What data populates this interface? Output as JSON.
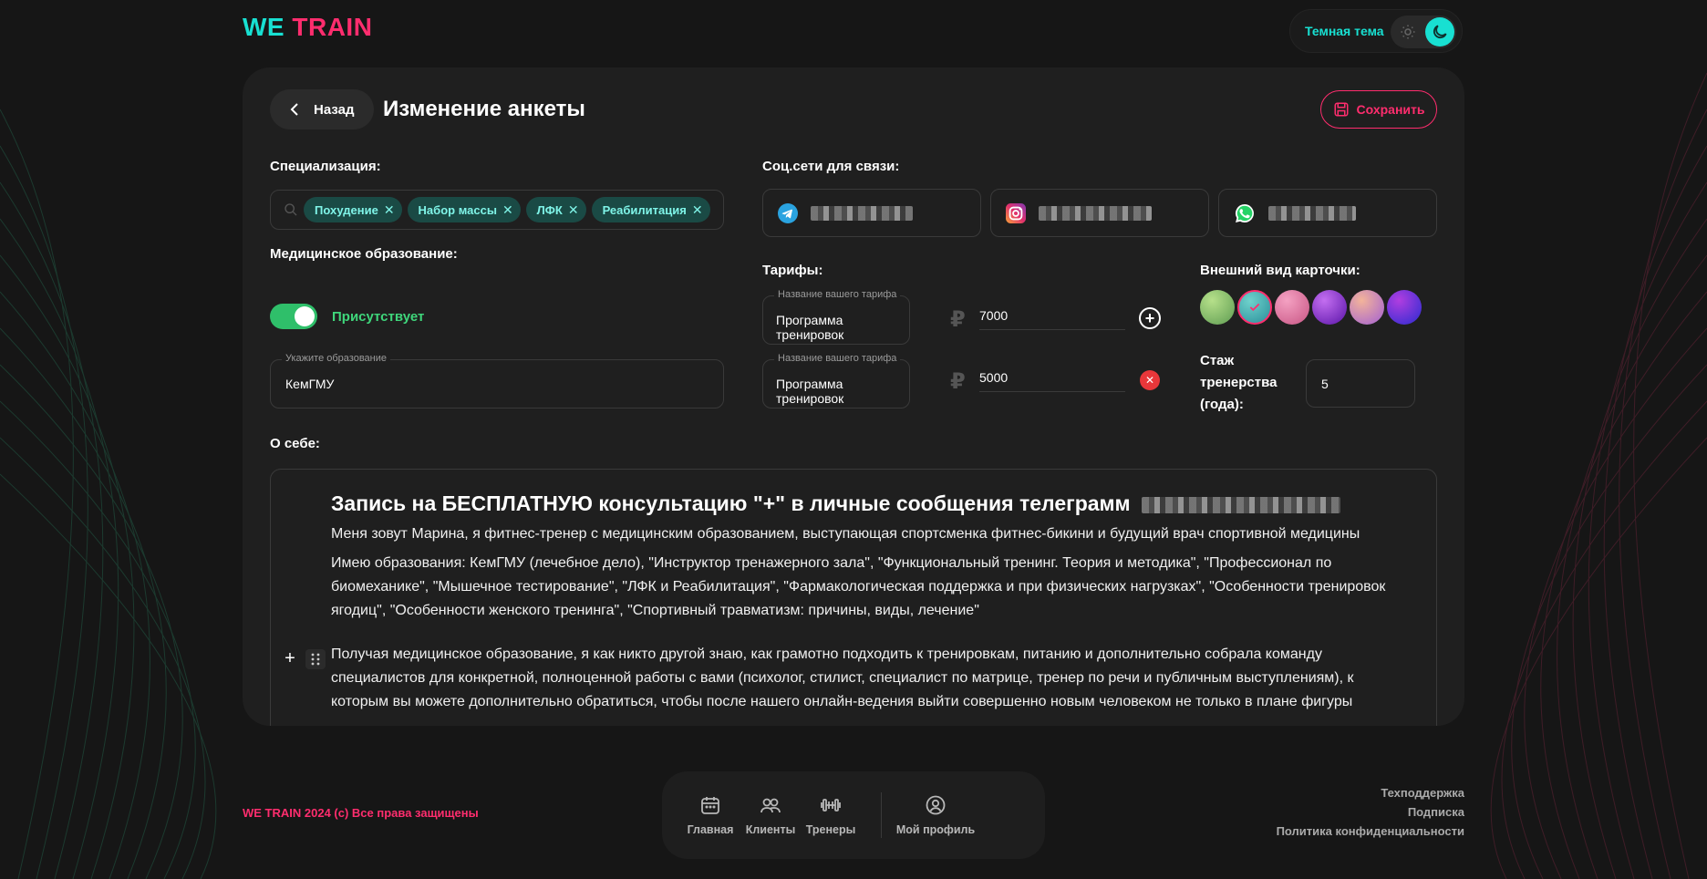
{
  "brand": {
    "part1": "WE",
    "part2": "TRAIN"
  },
  "theme": {
    "label": "Темная тема"
  },
  "header": {
    "back_label": "Назад",
    "title": "Изменение анкеты",
    "save_label": "Сохранить"
  },
  "specialization": {
    "label": "Специализация:",
    "chips": [
      "Похудение",
      "Набор массы",
      "ЛФК",
      "Реабилитация"
    ]
  },
  "social": {
    "label": "Соц.сети для связи:",
    "networks": [
      "telegram-icon",
      "instagram-icon",
      "whatsapp-icon"
    ]
  },
  "medical": {
    "label": "Медицинское образование:",
    "toggle_state": "Присутствует",
    "education_legend": "Укажите образование",
    "education_value": "КемГМУ"
  },
  "tariffs": {
    "label": "Тарифы:",
    "items": [
      {
        "legend": "Название вашего тарифа",
        "name": "Программа тренировок",
        "price": "7000"
      },
      {
        "legend": "Название вашего тарифа",
        "name": "Программа тренировок",
        "price": "5000"
      }
    ]
  },
  "appearance": {
    "label": "Внешний вид карточки:",
    "swatches": [
      "#7fc36a",
      "#3ab3b0",
      "#e46aa0",
      "#8a2bd6",
      "#c57ad8",
      "#4b2fd6"
    ],
    "selected_index": 1
  },
  "experience": {
    "label": "Стаж тренерства (года):",
    "value": "5"
  },
  "about": {
    "label": "О себе:",
    "heading": "Запись на БЕСПЛАТНУЮ консультацию \"+\" в личные сообщения телеграмм",
    "p1": "Меня зовут Марина, я фитнес-тренер с медицинским образованием, выступающая спортсменка фитнес-бикини и будущий врач спортивной медицины",
    "p2": "Имею образования: КемГМУ (лечебное дело), \"Инструктор тренажерного зала\", \"Функциональный тренинг. Теория и методика\", \"Профессионал по биомеханике\", \"Мышечное тестирование\", \"ЛФК и Реабилитация\", \"Фармакологическая поддержка и при физических нагрузках\", \"Особенности тренировок ягодиц\", \"Особенности женского тренинга\", \"Спортивный травматизм: причины, виды, лечение\"",
    "p3": "Получая медицинское образование, я как никто другой знаю, как грамотно подходить к тренировкам, питанию и дополнительно собрала команду специалистов для конкретной, полноценной работы с вами (психолог, стилист, специалист по матрице, тренер по речи и публичным выступлениям), к которым вы можете дополнительно обратиться, чтобы после нашего онлайн-ведения выйти совершенно новым человеком не только в плане фигуры"
  },
  "footer": {
    "copyright": "WE TRAIN 2024 (c) Все права защищены",
    "nav": [
      {
        "label": "Главная",
        "icon": "calendar-icon"
      },
      {
        "label": "Клиенты",
        "icon": "clients-icon"
      },
      {
        "label": "Тренеры",
        "icon": "dumbbell-icon"
      },
      {
        "label": "Мой профиль",
        "icon": "profile-icon"
      }
    ],
    "links": [
      "Техподдержка",
      "Подписка",
      "Политика конфиденциальности"
    ]
  },
  "colors": {
    "accent_cyan": "#18e0d2",
    "accent_pink": "#ff2d6e",
    "success": "#3fd67b",
    "danger": "#e8373a"
  }
}
